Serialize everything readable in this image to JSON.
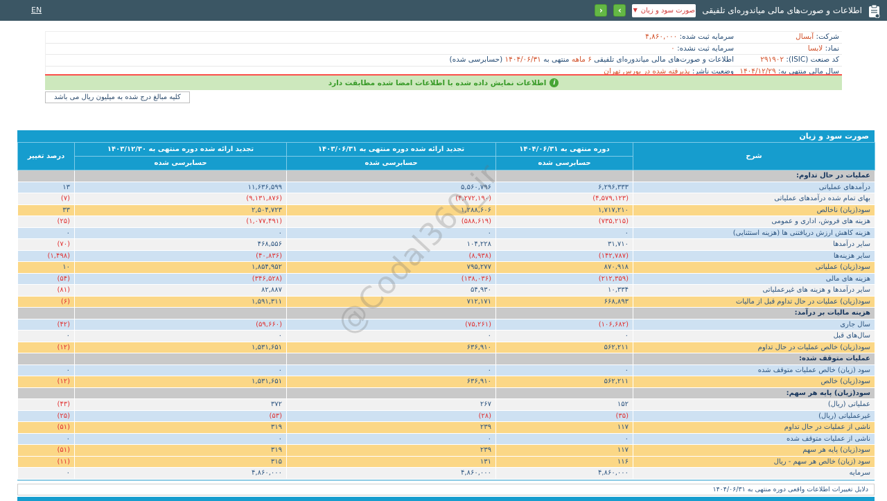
{
  "topbar": {
    "en": "EN",
    "title": "اطلاعات و صورت‌های مالی میاندوره‌ای تلفیقی",
    "dropdown_value": "صورت سود و زیان",
    "caret": "▼",
    "prev": "‹",
    "next": "›"
  },
  "info": {
    "right": [
      {
        "label": "شرکت:",
        "value": "آبسال"
      },
      {
        "label": "نماد:",
        "value": "لابسا"
      },
      {
        "label": "کد صنعت (ISIC):",
        "value": "۲۹۱۹۰۲"
      },
      {
        "label": "سال مالی منتهی به:",
        "value": "۱۴۰۴/۱۲/۲۹"
      }
    ],
    "left": [
      [
        {
          "t": "سرمایه ثبت شده: ",
          "c": "lbl"
        },
        {
          "t": "۴,۸۶۰,۰۰۰",
          "c": "val"
        }
      ],
      [
        {
          "t": "سرمایه ثبت نشده: ",
          "c": "lbl"
        },
        {
          "t": "۰",
          "c": "val"
        }
      ],
      [
        {
          "t": "اطلاعات و صورت‌های مالی میاندوره‌ای تلفیقی ",
          "c": "lbl"
        },
        {
          "t": "۶ ماهه",
          "c": "val"
        },
        {
          "t": "منتهی به ",
          "c": "lbl"
        },
        {
          "t": "۱۴۰۴/۰۶/۳۱",
          "c": "val"
        },
        {
          "t": "(حسابرسی شده)",
          "c": "lbl"
        }
      ],
      [
        {
          "t": "وضعیت ناشر: ",
          "c": "lbl"
        },
        {
          "t": "پذیرفته شده در بورس تهران",
          "c": "val"
        }
      ]
    ],
    "signature_notice": "اطلاعات نمایش داده شده با اطلاعات امضا شده مطابقت دارد",
    "info_icon": "i",
    "amounts_note": "کلیه مبالغ درج شده به میلیون ریال می باشد"
  },
  "table": {
    "title": "صورت سود و زیان",
    "headers": {
      "desc": "شرح",
      "pct": "درصد تغییر",
      "cols": [
        {
          "period": "دوره منتهی به ۱۴۰۴/۰۶/۳۱",
          "audit": "حسابرسی شده"
        },
        {
          "period": "تجدید ارائه شده دوره منتهی به ۱۴۰۳/۰۶/۳۱",
          "audit": "حسابرسی شده"
        },
        {
          "period": "تجدید ارائه شده دوره منتهی به ۱۴۰۳/۱۲/۳۰",
          "audit": "حسابرسی شده"
        }
      ]
    },
    "rows": [
      {
        "label": "عملیات در حال تداوم:",
        "style": "section",
        "v": [
          "",
          "",
          ""
        ],
        "pct": ""
      },
      {
        "label": "درآمدهای عملیاتی",
        "style": "blue",
        "v": [
          "۶,۲۹۶,۳۳۳",
          "۵,۵۶۰,۷۹۶",
          "۱۱,۶۳۶,۵۹۹"
        ],
        "pct": "۱۳"
      },
      {
        "label": "بهای تمام شده درآمدهای عملیاتی",
        "style": "white",
        "v": [
          "(۴,۵۷۹,۱۲۳)",
          "(۴,۲۷۲,۱۹۰)",
          "(۹,۱۳۱,۸۷۶)"
        ],
        "pct": "(۷)"
      },
      {
        "label": "سود(زیان) ناخالص",
        "style": "yellow",
        "v": [
          "۱,۷۱۷,۲۱۰",
          "۱,۲۸۸,۶۰۶",
          "۲,۵۰۴,۷۲۳"
        ],
        "pct": "۳۳"
      },
      {
        "label": "هزینه های فروش، اداری و عمومی",
        "style": "white",
        "v": [
          "(۷۳۵,۲۱۵)",
          "(۵۸۸,۶۱۹)",
          "(۱,۰۷۷,۴۹۱)"
        ],
        "pct": "(۲۵)"
      },
      {
        "label": "هزینه کاهش ارزش دریافتنی ها (هزینه استثنایی)",
        "style": "blue",
        "v": [
          "۰",
          "۰",
          "۰"
        ],
        "pct": "۰"
      },
      {
        "label": "سایر درآمدها",
        "style": "white",
        "v": [
          "۳۱,۷۱۰",
          "۱۰۴,۲۲۸",
          "۴۶۸,۵۵۶"
        ],
        "pct": "(۷۰)"
      },
      {
        "label": "سایر هزینه‌ها",
        "style": "blue",
        "v": [
          "(۱۴۲,۷۸۷)",
          "(۸,۹۳۸)",
          "(۴۰,۸۳۶)"
        ],
        "pct": "(۱,۴۹۸)"
      },
      {
        "label": "سود(زیان) عملیاتی",
        "style": "yellow",
        "v": [
          "۸۷۰,۹۱۸",
          "۷۹۵,۲۷۷",
          "۱,۸۵۴,۹۵۲"
        ],
        "pct": "۱۰"
      },
      {
        "label": "هزینه های مالی",
        "style": "blue",
        "v": [
          "(۲۱۲,۳۵۹)",
          "(۱۳۸,۰۳۶)",
          "(۳۴۶,۵۲۸)"
        ],
        "pct": "(۵۴)"
      },
      {
        "label": "سایر درآمدها و هزینه های غیرعملیاتی",
        "style": "white",
        "v": [
          "۱۰,۳۳۴",
          "۵۴,۹۳۰",
          "۸۲,۸۸۷"
        ],
        "pct": "(۸۱)"
      },
      {
        "label": "سود(زیان) عملیات در حال تداوم قبل از مالیات",
        "style": "yellow",
        "v": [
          "۶۶۸,۸۹۳",
          "۷۱۲,۱۷۱",
          "۱,۵۹۱,۳۱۱"
        ],
        "pct": "(۶)"
      },
      {
        "label": "هزینه مالیات بر درآمد:",
        "style": "section",
        "v": [
          "",
          "",
          ""
        ],
        "pct": ""
      },
      {
        "label": "سال جاری",
        "style": "blue",
        "v": [
          "(۱۰۶,۶۸۲)",
          "(۷۵,۲۶۱)",
          "(۵۹,۶۶۰)"
        ],
        "pct": "(۴۲)"
      },
      {
        "label": "سال‌های قبل",
        "style": "white",
        "v": [
          "۰",
          "۰",
          "۰"
        ],
        "pct": "۰"
      },
      {
        "label": "سود(زیان) خالص عملیات در حال تداوم",
        "style": "yellow",
        "v": [
          "۵۶۲,۲۱۱",
          "۶۳۶,۹۱۰",
          "۱,۵۳۱,۶۵۱"
        ],
        "pct": "(۱۲)"
      },
      {
        "label": "عملیات متوقف شده:",
        "style": "section",
        "v": [
          "",
          "",
          ""
        ],
        "pct": ""
      },
      {
        "label": "سود (زیان) خالص عملیات متوقف شده",
        "style": "blue",
        "v": [
          "۰",
          "۰",
          "۰"
        ],
        "pct": "۰"
      },
      {
        "label": "سود(زیان) خالص",
        "style": "yellow",
        "v": [
          "۵۶۲,۲۱۱",
          "۶۳۶,۹۱۰",
          "۱,۵۳۱,۶۵۱"
        ],
        "pct": "(۱۲)"
      },
      {
        "label": "سود(زیان) پایه هر سهم:",
        "style": "section",
        "v": [
          "",
          "",
          ""
        ],
        "pct": ""
      },
      {
        "label": "عملیاتی (ریال)",
        "style": "white",
        "v": [
          "۱۵۲",
          "۲۶۷",
          "۳۷۲"
        ],
        "pct": "(۴۳)"
      },
      {
        "label": "غیرعملیاتی (ریال)",
        "style": "blue",
        "v": [
          "(۳۵)",
          "(۲۸)",
          "(۵۳)"
        ],
        "pct": "(۲۵)"
      },
      {
        "label": "ناشی از عملیات در حال تداوم",
        "style": "yellow",
        "v": [
          "۱۱۷",
          "۲۳۹",
          "۳۱۹"
        ],
        "pct": "(۵۱)"
      },
      {
        "label": "ناشی از عملیات متوقف شده",
        "style": "blue",
        "v": [
          "۰",
          "۰",
          "۰"
        ],
        "pct": "۰"
      },
      {
        "label": "سود(زیان) پایه هر سهم",
        "style": "yellow",
        "v": [
          "۱۱۷",
          "۲۳۹",
          "۳۱۹"
        ],
        "pct": "(۵۱)"
      },
      {
        "label": "سود (زیان) خالص هر سهم - ریال",
        "style": "yellow",
        "v": [
          "۱۱۶",
          "۱۳۱",
          "۳۱۵"
        ],
        "pct": "(۱۱)"
      },
      {
        "label": "سرمایه",
        "style": "white",
        "v": [
          "۴,۸۶۰,۰۰۰",
          "۴,۸۶۰,۰۰۰",
          "۴,۸۶۰,۰۰۰"
        ],
        "pct": "۰"
      }
    ]
  },
  "footer": {
    "title": "دلایل تغییرات اطلاعات واقعی دوره منتهی به ۱۴۰۴/۰۶/۳۱"
  },
  "watermark": "@Codal360_ir",
  "colors": {
    "accent_teal": "#169dce",
    "header_slate": "#3b5664",
    "row_yellow": "#fbd786",
    "row_blue": "#cee1f2",
    "negative_red": "#e03232",
    "value_orange": "#d2512a",
    "notice_green": "#379a27"
  }
}
